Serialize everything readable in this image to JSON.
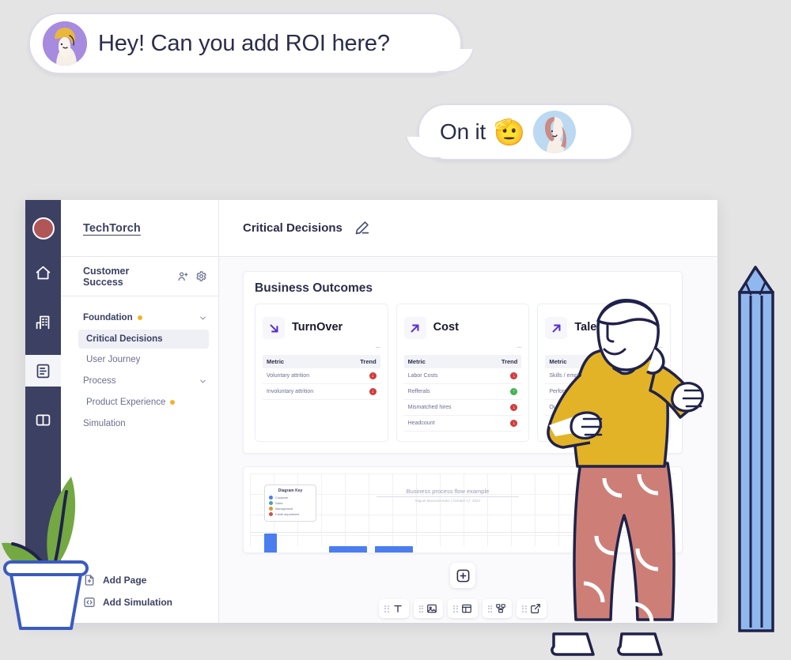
{
  "conversation": [
    {
      "id": "msg-1",
      "text": "Hey! Can you add ROI here?",
      "avatar_side": "left",
      "avatar": "blonde-person-avatar"
    },
    {
      "id": "msg-2",
      "text": "On it",
      "emoji": "🫡",
      "avatar_side": "right",
      "avatar": "red-hair-person-avatar"
    }
  ],
  "app": {
    "rail": {
      "logo": "app-logo",
      "items": [
        {
          "icon": "home-icon",
          "active": false
        },
        {
          "icon": "building-icon",
          "active": false
        },
        {
          "icon": "document-icon",
          "active": true
        },
        {
          "icon": "book-icon",
          "active": false
        }
      ]
    },
    "sidebar": {
      "brand": "TechTorch",
      "team": "Customer Success",
      "team_actions": [
        {
          "name": "add-member-icon",
          "label": "Add member"
        },
        {
          "name": "settings-gear-icon",
          "label": "Settings"
        }
      ],
      "tree": [
        {
          "type": "group",
          "label": "Foundation",
          "badge": true,
          "expanded": true
        },
        {
          "type": "item",
          "label": "Critical Decisions",
          "selected": true
        },
        {
          "type": "item",
          "label": "User Journey",
          "selected": false
        },
        {
          "type": "group",
          "label": "Process",
          "badge": false,
          "expanded": true
        },
        {
          "type": "item",
          "label": "Product Experience",
          "selected": false,
          "badge": true
        },
        {
          "type": "group-plain",
          "label": "Simulation",
          "badge": false
        }
      ],
      "footer": [
        {
          "label": "Add Page",
          "icon": "file-plus-icon"
        },
        {
          "label": "Add Simulation",
          "icon": "code-brackets-icon"
        }
      ]
    },
    "header": {
      "title": "Critical Decisions",
      "edit_icon": "pencil-edit-icon"
    },
    "outcomes": {
      "title": "Business Outcomes",
      "columns": [
        "Metric",
        "Trend"
      ],
      "cards": [
        {
          "name": "TurnOver",
          "icon": "arrow-down-right-icon",
          "icon_color": "#5b2fd4",
          "rows": [
            {
              "metric": "Voluntary attrition",
              "trend": "down"
            },
            {
              "metric": "Involuntary attrition",
              "trend": "down"
            }
          ]
        },
        {
          "name": "Cost",
          "icon": "arrow-up-right-icon",
          "icon_color": "#5b2fd4",
          "rows": [
            {
              "metric": "Labor Costs",
              "trend": "down"
            },
            {
              "metric": "Refferals",
              "trend": "up"
            },
            {
              "metric": "Mismatched hires",
              "trend": "down"
            },
            {
              "metric": "Headcount",
              "trend": "down"
            }
          ]
        },
        {
          "name": "Talent Quality",
          "icon": "arrow-up-right-icon",
          "icon_color": "#5b2fd4",
          "rows": [
            {
              "metric": "Skills / employee",
              "trend": "up"
            },
            {
              "metric": "Performance reviews",
              "trend": "none"
            },
            {
              "metric": "Output",
              "trend": "none"
            }
          ]
        }
      ]
    },
    "diagram_block": {
      "title": "Business process flow example",
      "subtitle": "Miguel Maciomiendez  |  October 17, 2022",
      "key_title": "Diagram Key",
      "key_items": [
        {
          "label": "Customer",
          "color": "#4a7ef0"
        },
        {
          "label": "Sales",
          "color": "#4aa3a8"
        },
        {
          "label": "Management",
          "color": "#e0912e"
        },
        {
          "label": "Credit department",
          "color": "#c4564f"
        }
      ]
    },
    "add_block_button": {
      "icon": "plus-square-icon",
      "label": "Add block"
    },
    "toolbar": [
      {
        "name": "tool-text",
        "icon": "text-icon",
        "label": "Text"
      },
      {
        "name": "tool-image",
        "icon": "image-icon",
        "label": "Image"
      },
      {
        "name": "tool-table",
        "icon": "table-icon",
        "label": "Table"
      },
      {
        "name": "tool-diagram",
        "icon": "diagram-icon",
        "label": "Diagram"
      },
      {
        "name": "tool-embed",
        "icon": "external-link-icon",
        "label": "Embed"
      }
    ]
  },
  "colors": {
    "background": "#e4e4e4",
    "rail": "#3c4063",
    "accent_purple": "#5b2fd4",
    "badge_yellow": "#f0b429",
    "trend_down": "#d23b3b",
    "trend_up": "#3fb34f",
    "text_dark": "#2b2d4a"
  }
}
